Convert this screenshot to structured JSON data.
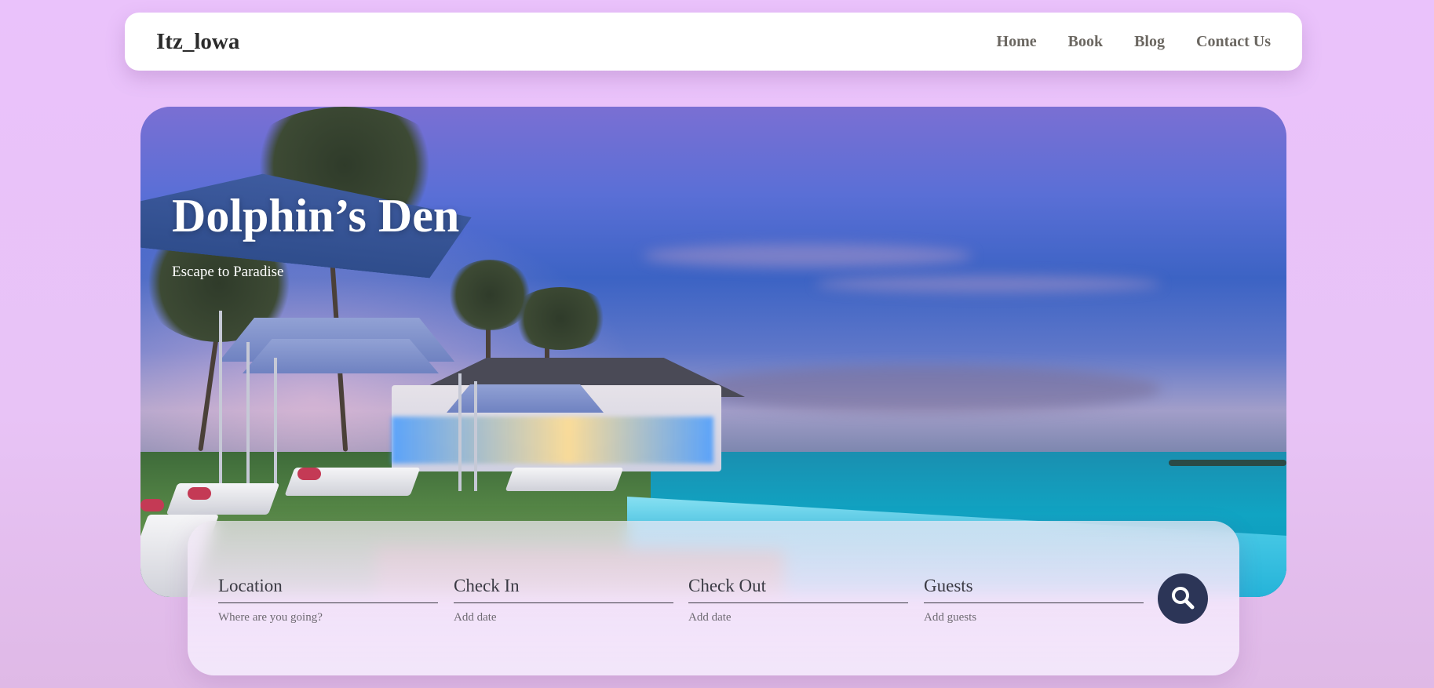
{
  "navbar": {
    "brand": "Itz_lowa",
    "links": [
      "Home",
      "Book",
      "Blog",
      "Contact Us"
    ]
  },
  "hero": {
    "title": "Dolphin’s Den",
    "subtitle": "Escape to Paradise"
  },
  "search": {
    "fields": [
      {
        "label": "Location",
        "placeholder": "Where are you going?"
      },
      {
        "label": "Check In",
        "placeholder": "Add date"
      },
      {
        "label": "Check Out",
        "placeholder": "Add date"
      },
      {
        "label": "Guests",
        "placeholder": "Add guests"
      }
    ],
    "button_icon": "search-icon"
  },
  "colors": {
    "background": "#eac2fb",
    "navbar_bg": "#ffffff",
    "nav_link": "#6b6761",
    "search_button": "#2c3557"
  }
}
